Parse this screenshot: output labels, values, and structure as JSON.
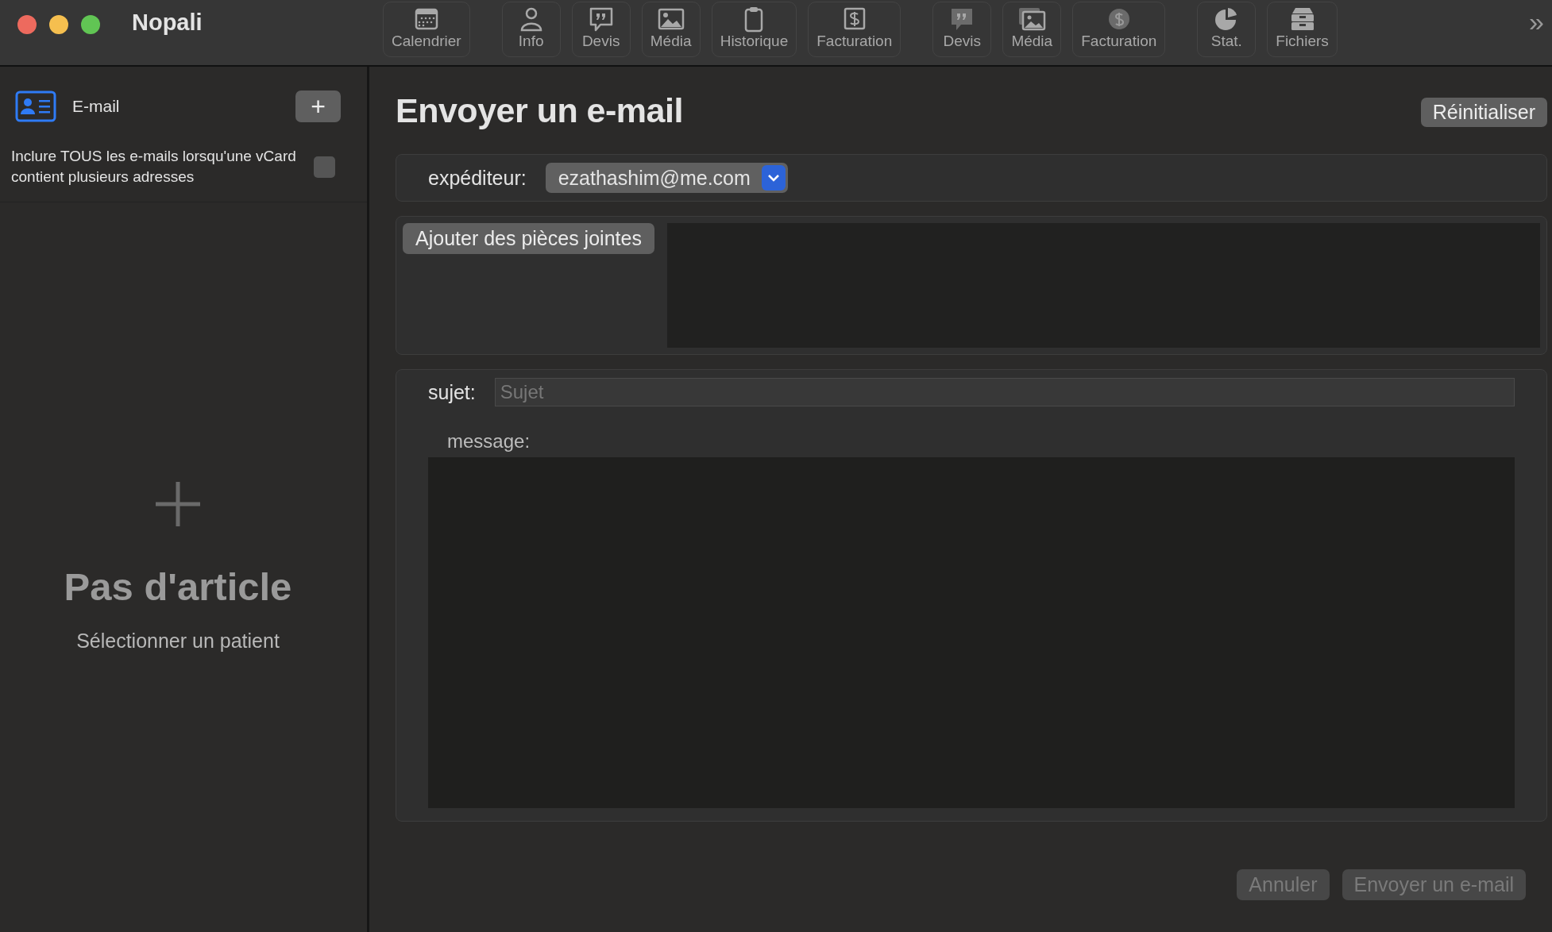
{
  "window": {
    "title": "Nopali"
  },
  "toolbar": {
    "groups": [
      [
        {
          "label": "Calendrier"
        }
      ],
      [
        {
          "label": "Info"
        },
        {
          "label": "Devis"
        },
        {
          "label": "Média"
        },
        {
          "label": "Historique"
        },
        {
          "label": "Facturation"
        }
      ],
      [
        {
          "label": "Devis"
        },
        {
          "label": "Média"
        },
        {
          "label": "Facturation"
        }
      ],
      [
        {
          "label": "Stat."
        },
        {
          "label": "Fichiers"
        }
      ]
    ],
    "overflow": "»"
  },
  "sidebar": {
    "title": "E-mail",
    "add_button": "+",
    "option": {
      "label": "Inclure TOUS les e-mails lorsqu'une vCard contient plusieurs adresses",
      "checked": false
    },
    "empty": {
      "title": "Pas d'article",
      "subtitle": "Sélectionner un patient"
    }
  },
  "form": {
    "title": "Envoyer un e-mail",
    "reset_button": "Réinitialiser",
    "sender": {
      "label": "expéditeur:",
      "value": "ezathashim@me.com"
    },
    "attach_button": "Ajouter des pièces jointes",
    "subject": {
      "label": "sujet:",
      "placeholder": "Sujet"
    },
    "message": {
      "label": "message:"
    },
    "buttons": [
      {
        "label": "Annuler",
        "disabled": true
      },
      {
        "label": "Envoyer un e-mail",
        "disabled": true
      }
    ]
  }
}
